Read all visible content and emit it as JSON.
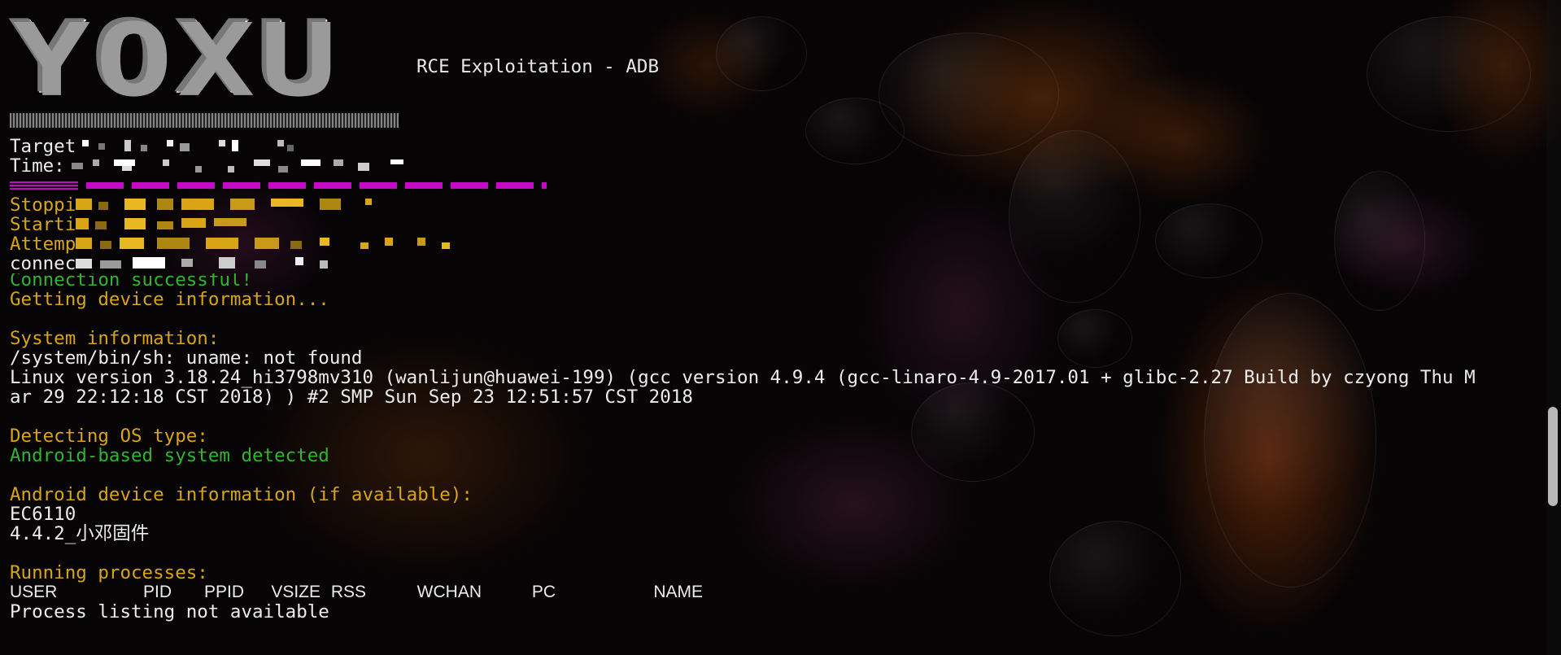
{
  "banner": {
    "logo_text": "YOXU",
    "subtitle": "RCE Exploitation - ADB"
  },
  "header": {
    "target_label": "Target",
    "time_label": "Time:"
  },
  "output": {
    "stopping": "Stoppi",
    "starting": "Starti",
    "attempting": "Attemp",
    "connected": "connec",
    "connection_success": "Connection successful!",
    "getting_info": "Getting device information...",
    "system_info_heading": "System information:",
    "uname_error": "/system/bin/sh: uname: not found",
    "kernel_line_1": "Linux version 3.18.24_hi3798mv310 (wanlijun@huawei-199) (gcc version 4.9.4 (gcc-linaro-4.9-2017.01 + glibc-2.27 Build by czyong Thu M",
    "kernel_line_2": "ar 29 22:12:18 CST 2018) ) #2 SMP Sun Sep 23 12:51:57 CST 2018",
    "detect_os_heading": "Detecting OS type:",
    "os_detected": "Android-based system detected",
    "android_info_heading": "Android device information (if available):",
    "device_model": "EC6110",
    "firmware": "4.4.2_小邓固件",
    "processes_heading": "Running processes:",
    "process_columns": [
      "USER",
      "PID",
      "PPID",
      "VSIZE",
      "RSS",
      "WCHAN",
      "PC",
      "NAME"
    ],
    "process_listing": "Process listing not available"
  },
  "colors": {
    "text": "#ececec",
    "warning": "#d9a514",
    "success": "#2fb52f",
    "separator": "#c40ac4"
  }
}
